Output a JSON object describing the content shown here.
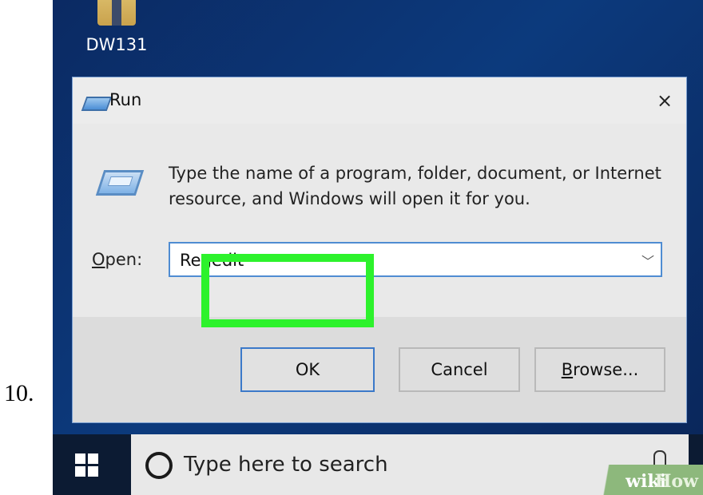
{
  "step": {
    "number": "10."
  },
  "desktop": {
    "folder_label": "DW131"
  },
  "dialog": {
    "title": "Run",
    "close": "×",
    "description": "Type the name of a program, folder, document, or Internet resource, and Windows will open it for you.",
    "open_label_first": "O",
    "open_label_rest": "pen:",
    "input_value": "Regedit",
    "ok_label": "OK",
    "cancel_label": "Cancel",
    "browse_label_first": "B",
    "browse_label_rest": "rowse..."
  },
  "taskbar": {
    "search_placeholder": "Type here to search"
  },
  "watermark": {
    "wiki": "wiki",
    "how": "How"
  },
  "colors": {
    "highlight": "#2df22c",
    "desktop": "#0c3a7d",
    "dialog_border": "#7a9fd2"
  }
}
